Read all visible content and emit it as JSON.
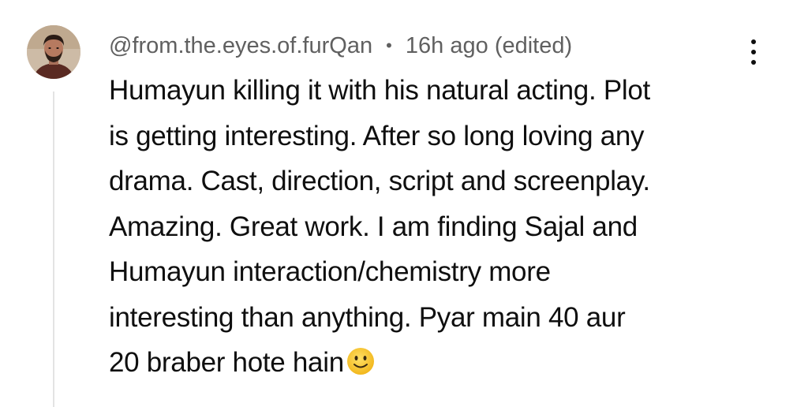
{
  "comment": {
    "author": "@from.the.eyes.of.furQan",
    "separator": "•",
    "time": "16h ago",
    "edited": "(edited)",
    "lines": [
      "Humayun killing it with his natural acting. Plot",
      "is getting interesting. After so long loving any",
      "drama. Cast, direction, script and screenplay.",
      "Amazing. Great work. I am finding Sajal and",
      "Humayun interaction/chemistry more",
      "interesting than anything. Pyar main 40 aur",
      "20 braber hote hain"
    ],
    "trailing_emoji": "slightly-smiling-face-icon",
    "menu_icon": "more-vertical-icon"
  },
  "colors": {
    "meta_text": "#606060",
    "body_text": "#0f0f0f",
    "thread_line": "#e3e3e3",
    "emoji_fill": "#f7c325"
  }
}
